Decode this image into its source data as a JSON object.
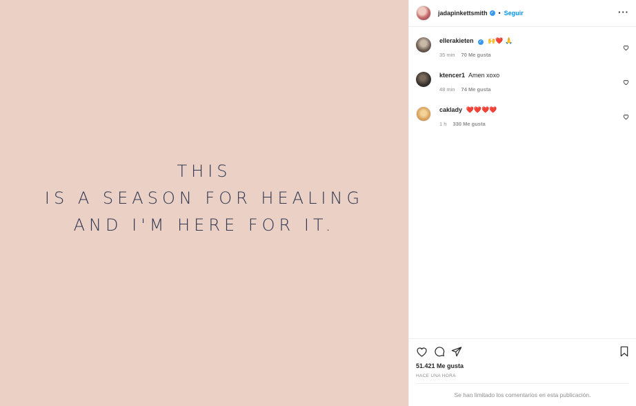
{
  "media": {
    "background": "#ebd0c6",
    "text_color": "#2e3650",
    "lines": [
      "THIS",
      "IS A SEASON FOR HEALING",
      "AND I'M HERE FOR IT."
    ]
  },
  "header": {
    "username": "jadapinkettsmith",
    "verified": true,
    "separator": "•",
    "follow_label": "Seguir",
    "more_label": "···"
  },
  "comments": [
    {
      "username": "ellerakieten",
      "verified": true,
      "text": "🙌❤️ 🙏",
      "time": "35 min",
      "likes": "70 Me gusta"
    },
    {
      "username": "ktencer1",
      "verified": false,
      "text": "Amen xoxo",
      "time": "48 min",
      "likes": "74 Me gusta"
    },
    {
      "username": "caklady",
      "verified": false,
      "text": "❤️❤️❤️❤️",
      "time": "1 h",
      "likes": "330 Me gusta"
    }
  ],
  "actions": {
    "like_icon": "heart-icon",
    "comment_icon": "comment-icon",
    "share_icon": "share-icon",
    "save_icon": "bookmark-icon"
  },
  "likes_total": "51.421 Me gusta",
  "time_ago": "HACE UNA HORA",
  "comments_limited": "Se han limitado los comentarios en esta publicación.",
  "colors": {
    "accent": "#0095f6",
    "verified": "#3897f0",
    "muted": "#8e8e8e"
  }
}
